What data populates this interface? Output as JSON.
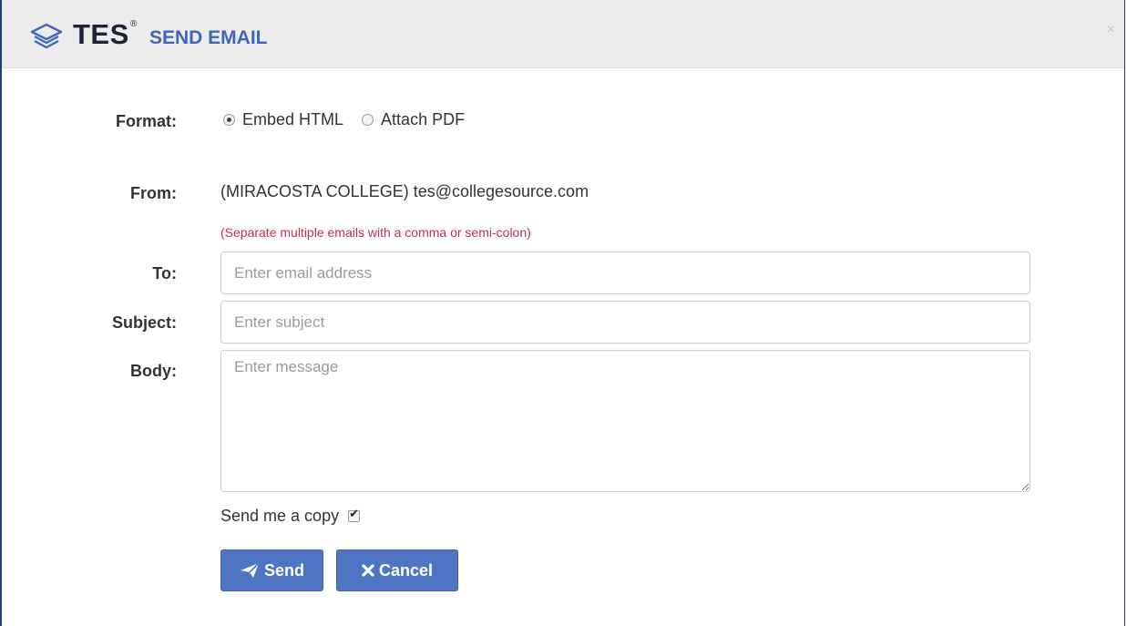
{
  "header": {
    "brand": "TES",
    "brand_mark": "®",
    "title": "SEND EMAIL",
    "close_label": "×",
    "colors": {
      "header_bg": "#ececec",
      "title": "#3f66b8",
      "brand": "#1d2433"
    }
  },
  "form": {
    "format": {
      "label": "Format:",
      "options": [
        {
          "label": "Embed HTML",
          "selected": true
        },
        {
          "label": "Attach PDF",
          "selected": false
        }
      ]
    },
    "from": {
      "label": "From:",
      "value": "(MIRACOSTA COLLEGE) tes@collegesource.com"
    },
    "hint": "(Separate multiple emails with a comma or semi-colon)",
    "to": {
      "label": "To:",
      "value": "",
      "placeholder": "Enter email address"
    },
    "subject": {
      "label": "Subject:",
      "value": "",
      "placeholder": "Enter subject"
    },
    "body": {
      "label": "Body:",
      "value": "",
      "placeholder": "Enter message"
    },
    "send_copy": {
      "label": "Send me a copy",
      "checked": true
    }
  },
  "actions": {
    "send_label": "Send",
    "send_icon": "paper-plane-icon",
    "cancel_label": "Cancel",
    "cancel_icon": "close-icon",
    "button_color": "#5074c4"
  }
}
